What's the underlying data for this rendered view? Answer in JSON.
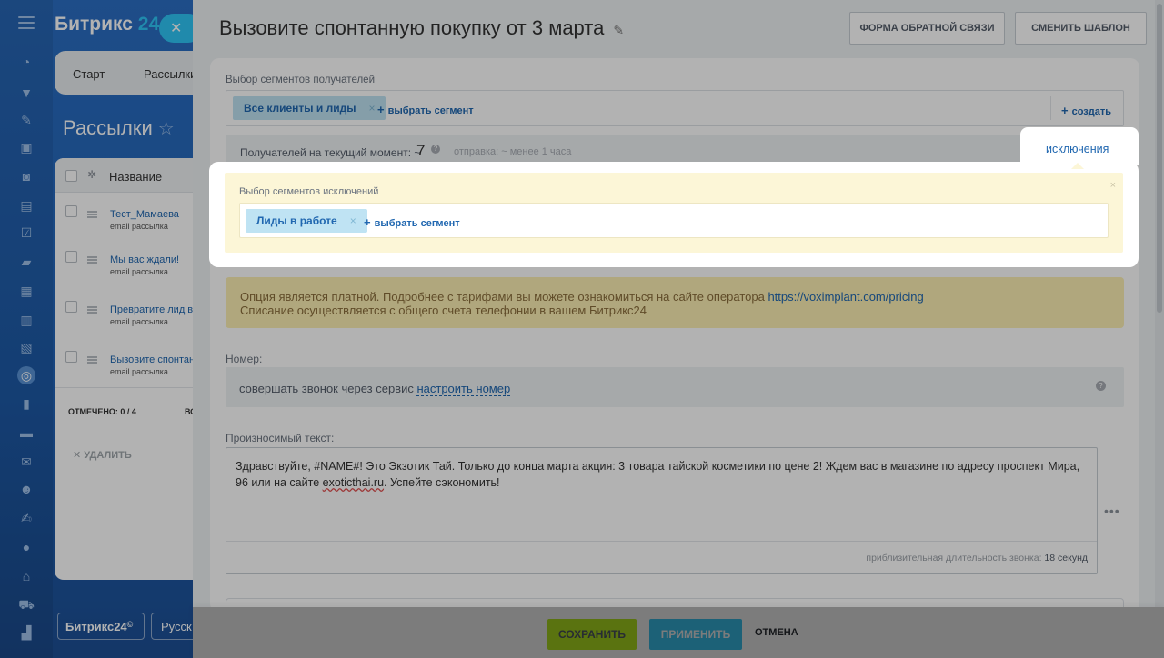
{
  "app": {
    "logo_main": "Битрикс",
    "logo_num": "24",
    "close_glyph": "✕",
    "tabs": [
      "Старт",
      "Рассылки"
    ],
    "page_title": "Рассылки",
    "star_glyph": "☆",
    "grid": {
      "col_name": "Название",
      "rows": [
        {
          "title": "Тест_Мамаева",
          "subtitle": "email рассылка"
        },
        {
          "title": "Мы вас ждали!",
          "subtitle": "email рассылка"
        },
        {
          "title": "Превратите лид в",
          "subtitle": "email рассылка"
        },
        {
          "title": "Вызовите спонтан",
          "subtitle": "email рассылка"
        }
      ],
      "marked": "ОТМЕЧЕНО: 0 / 4",
      "marked_tail": "ВС",
      "delete_label": "✕ УДАЛИТЬ"
    },
    "footer_logo": "Битрикс24",
    "footer_logo_mark": "©",
    "footer_lang": "Русск"
  },
  "panel": {
    "title": "Вызовите спонтанную покупку от 3 марта",
    "pencil_glyph": "✎",
    "btn_feedback": "ФОРМА ОБРАТНОЙ СВЯЗИ",
    "btn_template": "СМЕНИТЬ ШАБЛОН",
    "segments": {
      "label": "Выбор сегментов получателей",
      "chip": "Все клиенты и лиды",
      "chip_x": "×",
      "add": "выбрать сегмент",
      "create": "создать"
    },
    "count": {
      "label": "Получателей на текущий момент: ~",
      "value": "7",
      "help": "?",
      "send": "отправка: ~ менее 1 часа"
    },
    "notice": {
      "line1_text": "Опция является платной. Подробнее с тарифами вы можете ознакомиться на сайте оператора ",
      "line1_link": "https://voximplant.com/pricing",
      "line2": "Списание осуществляется с общего счета телефонии в вашем Битрикс24"
    },
    "number": {
      "label": "Номер:",
      "text": "совершать звонок через сервис ",
      "link": "настроить номер",
      "help": "?"
    },
    "speech": {
      "label": "Произносимый текст:",
      "text_before": "Здравствуйте, #NAME#! Это Экзотик Тай. Только до конца марта акция: 3 товара тайской косметики по цене 2! Ждем вас в магазине по адресу проспект Мира, 96 или на сайте ",
      "text_spell": "exoticthai.ru",
      "text_after": ". Успейте сэкономить!",
      "duration_label": "приблизительная длительность звонка:",
      "duration_value": "18 секунд",
      "more": "•••"
    }
  },
  "exclusions": {
    "tab_link": "исключения",
    "title": "Выбор сегментов исключений",
    "close": "×",
    "chip": "Лиды в работе",
    "chip_x": "×",
    "add": "выбрать сегмент"
  },
  "footer": {
    "save": "СОХРАНИТЬ",
    "apply": "ПРИМЕНИТЬ",
    "cancel": "ОТМЕНА"
  },
  "colors": {
    "save": "#bbed21",
    "apply": "#3bc8f5",
    "link": "#2067b0",
    "chip": "#bfe3f3",
    "notice": "#fcefb3",
    "exclusion_bg": "#fcf6d7"
  },
  "plus_glyph": "+"
}
